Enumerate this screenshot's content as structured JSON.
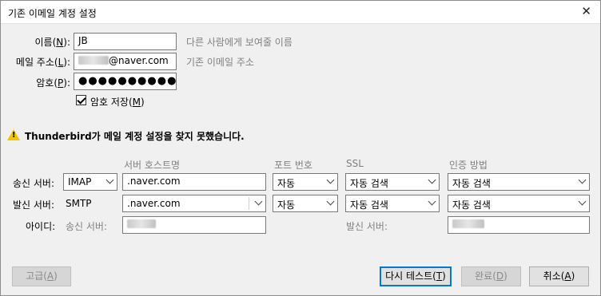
{
  "window": {
    "title": "기존 이메일 계정 설정"
  },
  "identity": {
    "name_label_pre": "이름(",
    "name_label_key": "N",
    "name_label_post": "):",
    "name_value": "JB",
    "name_hint": "다른 사람에게 보여줄 이름",
    "email_label_pre": "메일 주소(",
    "email_label_key": "L",
    "email_label_post": "):",
    "email_value_suffix": "@naver.com",
    "email_hint": "기존 이메일 주소",
    "password_label_pre": "암호(",
    "password_label_key": "P",
    "password_label_post": "):",
    "password_mask": "●●●●●●●●●●●",
    "remember_label_pre": "암호 저장(",
    "remember_label_key": "M",
    "remember_label_post": ")",
    "remember_checked": true
  },
  "warning": {
    "message": "Thunderbird가 메일 계정 설정을 찾지 못했습니다."
  },
  "server_table": {
    "headers": {
      "hostname": "서버 호스트명",
      "port": "포트 번호",
      "ssl": "SSL",
      "auth": "인증 방법"
    },
    "incoming": {
      "label": "송신 서버:",
      "protocol": "IMAP",
      "hostname": ".naver.com",
      "port": "자동",
      "ssl": "자동 검색",
      "auth": "자동 검색"
    },
    "outgoing": {
      "label": "발신 서버:",
      "protocol": "SMTP",
      "hostname": ".naver.com",
      "port": "자동",
      "ssl": "자동 검색",
      "auth": "자동 검색"
    },
    "username": {
      "label": "아이디:",
      "incoming_label": "송신 서버:",
      "outgoing_label": "발신 서버:"
    }
  },
  "buttons": {
    "advanced_pre": "고급(",
    "advanced_key": "A",
    "advanced_post": ")",
    "retest_pre": "다시 테스트(",
    "retest_key": "T",
    "retest_post": ")",
    "done_pre": "완료(",
    "done_key": "D",
    "done_post": ")",
    "cancel_pre": "취소(",
    "cancel_key": "A",
    "cancel_post": ")"
  },
  "colors": {
    "warning": "#f5c400",
    "default_button_border": "#0078d7"
  },
  "icons": {
    "close": "close-icon",
    "warning": "warning-icon",
    "dropdown": "chevron-down-icon",
    "checkbox": "check-icon"
  }
}
